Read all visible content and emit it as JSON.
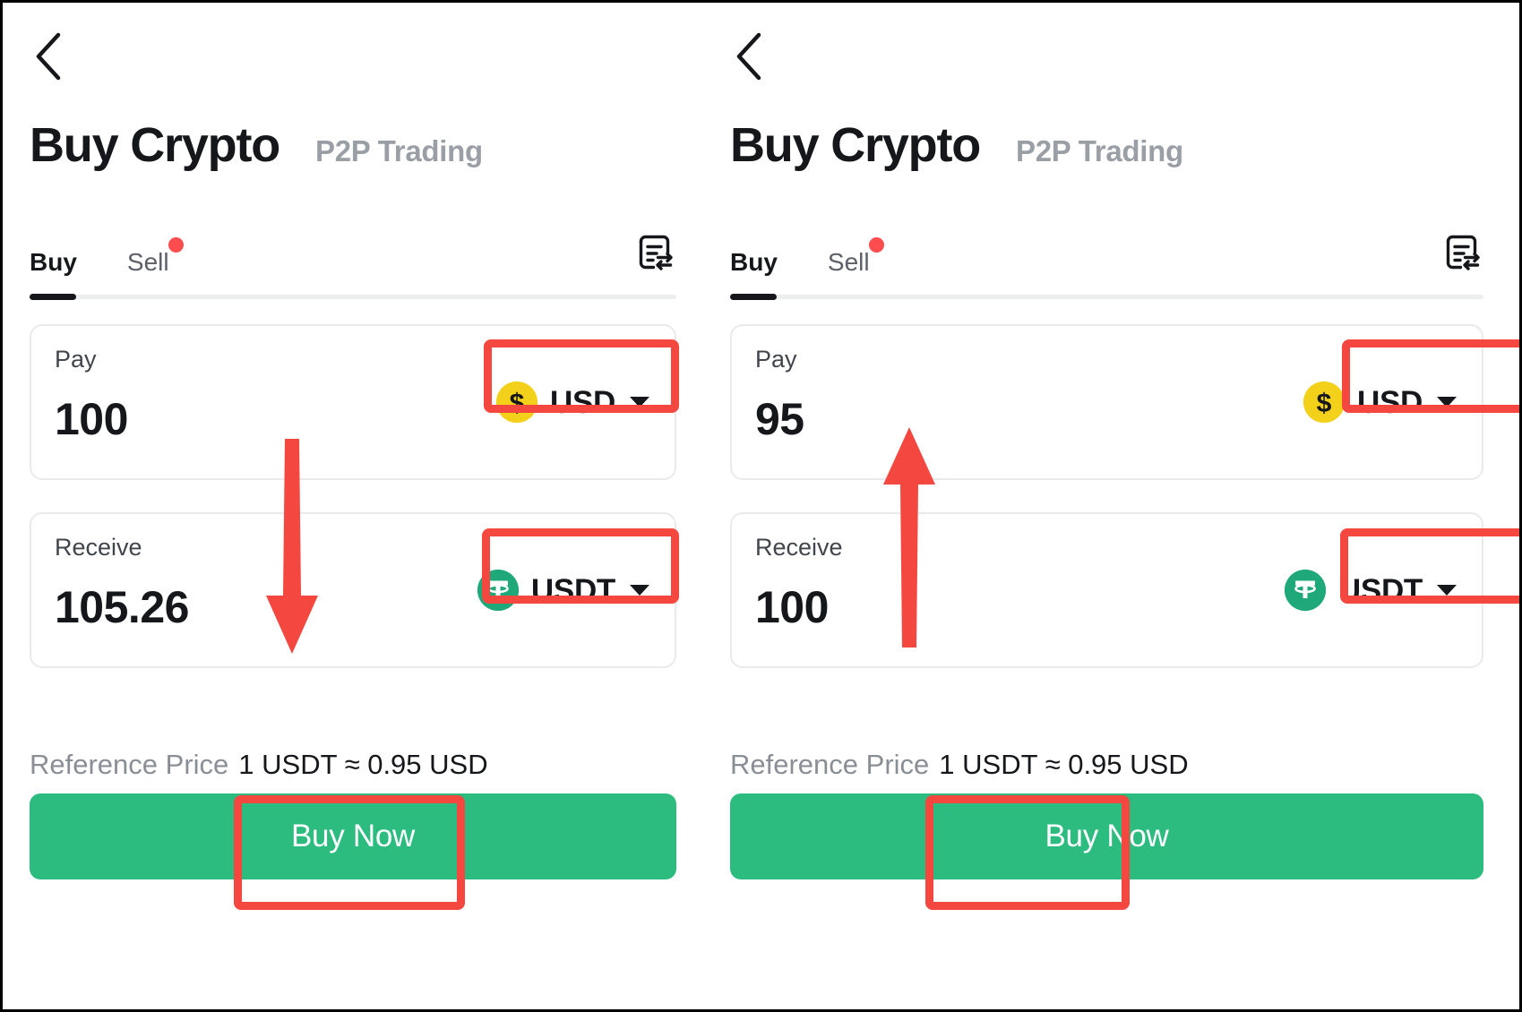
{
  "frame": {
    "accent_red": "#f4473f",
    "accent_green": "#2cbc80",
    "usd_coin_color": "#f3d019",
    "usdt_coin_color": "#1fa97a"
  },
  "panels": [
    {
      "id": "before",
      "back_icon": "chevron-left-icon",
      "title": "Buy Crypto",
      "subtitle": "P2P Trading",
      "tabs": [
        {
          "label": "Buy",
          "active": true,
          "dot": false
        },
        {
          "label": "Sell",
          "active": false,
          "dot": true
        }
      ],
      "orders_icon": "order-history-icon",
      "pay": {
        "label": "Pay",
        "value": "100",
        "currency": "USD",
        "currency_icon": "dollar-coin-icon",
        "caret_icon": "chevron-down-icon"
      },
      "receive": {
        "label": "Receive",
        "value": "105.26",
        "currency": "USDT",
        "currency_icon": "tether-coin-icon",
        "caret_icon": "chevron-down-icon"
      },
      "reference": {
        "label": "Reference Price",
        "value": "1 USDT ≈ 0.95 USD"
      },
      "cta": {
        "label": "Buy Now"
      },
      "arrow": {
        "direction": "down",
        "color": "#f4473f"
      }
    },
    {
      "id": "after",
      "back_icon": "chevron-left-icon",
      "title": "Buy Crypto",
      "subtitle": "P2P Trading",
      "tabs": [
        {
          "label": "Buy",
          "active": true,
          "dot": false
        },
        {
          "label": "Sell",
          "active": false,
          "dot": true
        }
      ],
      "orders_icon": "order-history-icon",
      "pay": {
        "label": "Pay",
        "value": "95",
        "currency": "USD",
        "currency_icon": "dollar-coin-icon",
        "caret_icon": "chevron-down-icon"
      },
      "receive": {
        "label": "Receive",
        "value": "100",
        "currency": "USDT",
        "currency_icon": "tether-coin-icon",
        "caret_icon": "chevron-down-icon"
      },
      "reference": {
        "label": "Reference Price",
        "value": "1 USDT ≈ 0.95 USD"
      },
      "cta": {
        "label": "Buy Now"
      },
      "arrow": {
        "direction": "up",
        "color": "#f4473f"
      }
    }
  ]
}
